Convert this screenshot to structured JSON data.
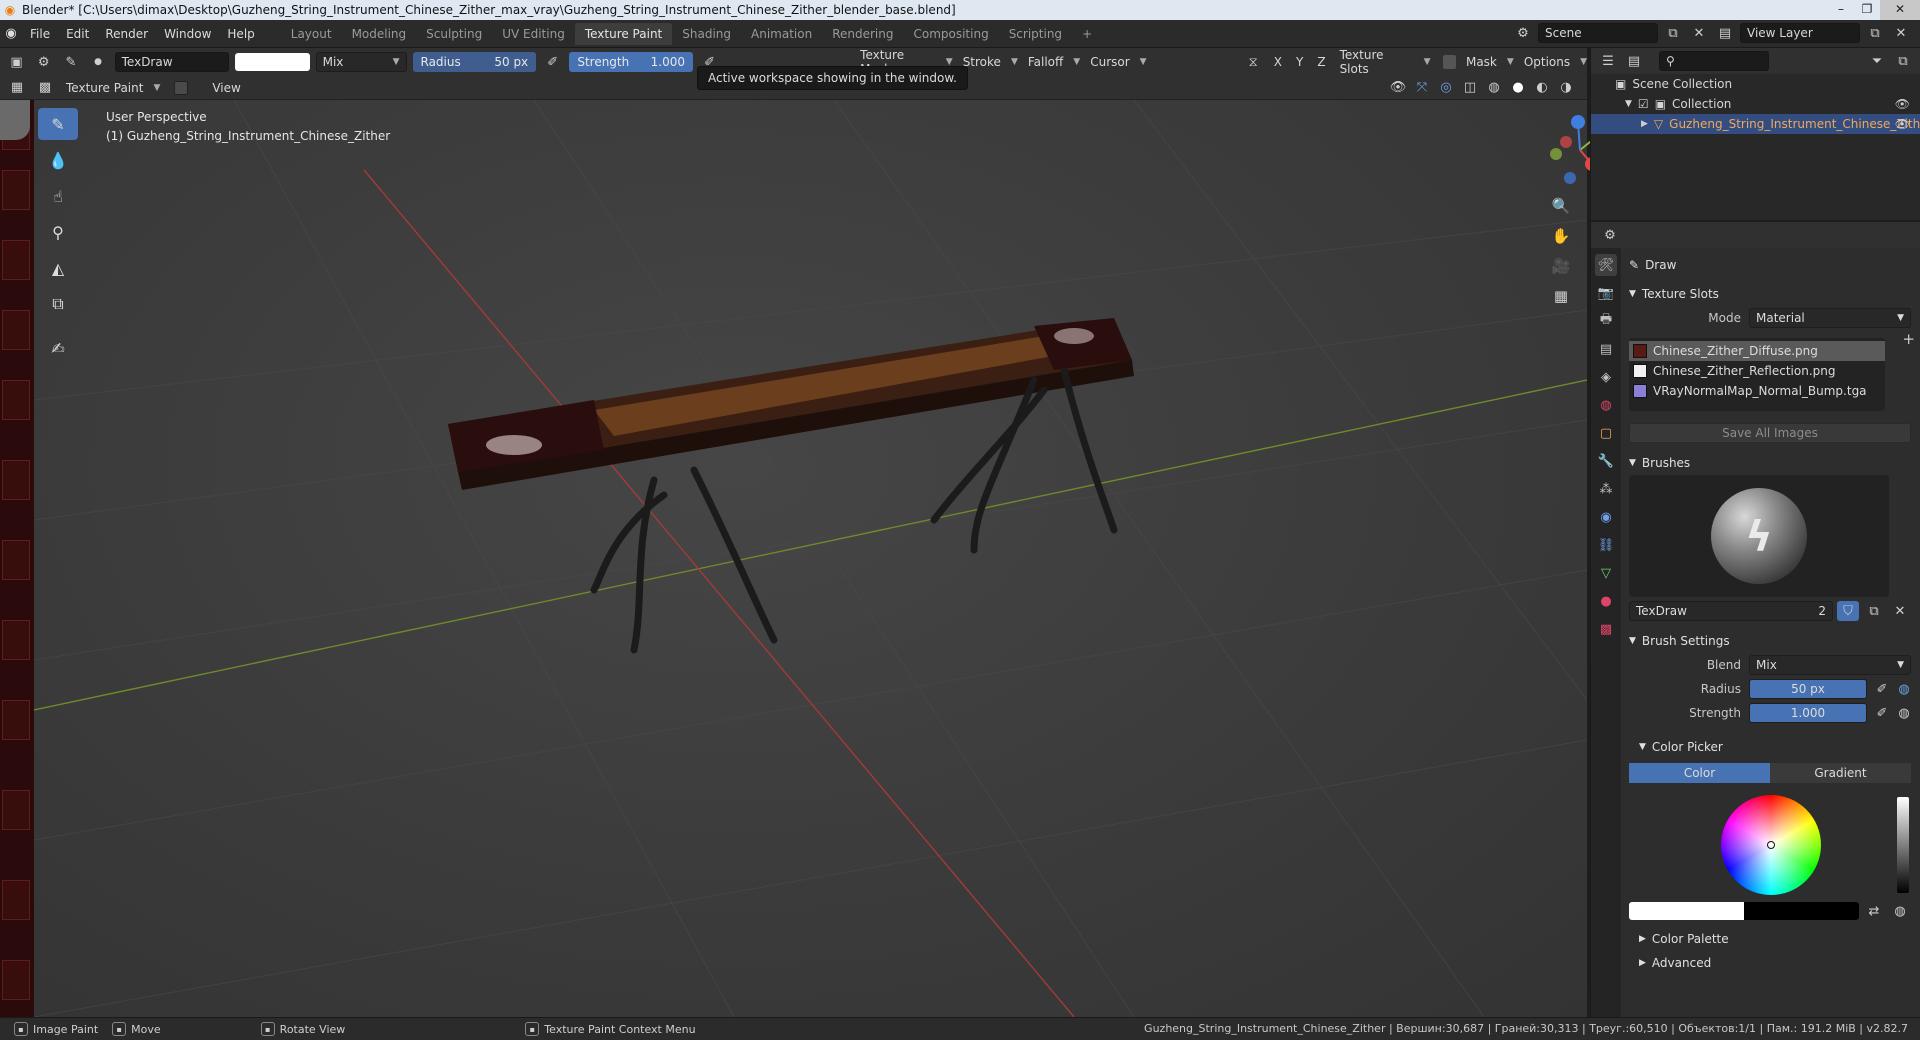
{
  "titlebar": {
    "title": "Blender* [C:\\Users\\dimax\\Desktop\\Guzheng_String_Instrument_Chinese_Zither_max_vray\\Guzheng_String_Instrument_Chinese_Zither_blender_base.blend]"
  },
  "menu": [
    "File",
    "Edit",
    "Render",
    "Window",
    "Help"
  ],
  "workspaces": [
    "Layout",
    "Modeling",
    "Sculpting",
    "UV Editing",
    "Texture Paint",
    "Shading",
    "Animation",
    "Rendering",
    "Compositing",
    "Scripting"
  ],
  "active_workspace": "Texture Paint",
  "scene": {
    "name": "Scene",
    "view_layer": "View Layer"
  },
  "tool_header": {
    "brush_name": "TexDraw",
    "blend": "Mix",
    "radius_label": "Radius",
    "radius_value": "50 px",
    "strength_label": "Strength",
    "strength_value": "1.000",
    "texture_mask": "Texture Mask",
    "stroke": "Stroke",
    "falloff": "Falloff",
    "cursor": "Cursor",
    "axes": [
      "X",
      "Y",
      "Z"
    ],
    "texture_slots": "Texture Slots",
    "mask": "Mask",
    "options": "Options"
  },
  "header2": {
    "mode": "Texture Paint",
    "view": "View"
  },
  "tooltip": "Active workspace showing in the window.",
  "viewport": {
    "perspective": "User Perspective",
    "object": "(1) Guzheng_String_Instrument_Chinese_Zither"
  },
  "outliner": {
    "scene_collection": "Scene Collection",
    "collection": "Collection",
    "object": "Guzheng_String_Instrument_Chinese_Zither"
  },
  "properties": {
    "tool_name": "Draw",
    "texture_slots_title": "Texture Slots",
    "mode_label": "Mode",
    "mode_value": "Material",
    "slots": [
      {
        "name": "Chinese_Zither_Diffuse.png",
        "color": "#5a1a14"
      },
      {
        "name": "Chinese_Zither_Reflection.png",
        "color": "#f2f2f2"
      },
      {
        "name": "VRayNormalMap_Normal_Bump.tga",
        "color": "#8a7fd6"
      }
    ],
    "save_all": "Save All Images",
    "brushes_title": "Brushes",
    "brush_name": "TexDraw",
    "brush_users": "2",
    "brush_settings_title": "Brush Settings",
    "blend_label": "Blend",
    "blend_value": "Mix",
    "radius_label": "Radius",
    "radius_value": "50 px",
    "strength_label": "Strength",
    "strength_value": "1.000",
    "color_picker_title": "Color Picker",
    "tab_color": "Color",
    "tab_gradient": "Gradient",
    "color_palette": "Color Palette",
    "advanced": "Advanced"
  },
  "statusbar": {
    "image_paint": "Image Paint",
    "move": "Move",
    "rotate": "Rotate View",
    "context": "Texture Paint Context Menu",
    "stats": "Guzheng_String_Instrument_Chinese_Zither | Вершин:30,687 | Граней:30,313 | Треуг.:60,510 | Объектов:1/1 | Пам.: 191.2 MiB | v2.82.7"
  },
  "colors": {
    "accent": "#4772b3",
    "selection": "#334d80",
    "brush_color": "#ffffff"
  }
}
